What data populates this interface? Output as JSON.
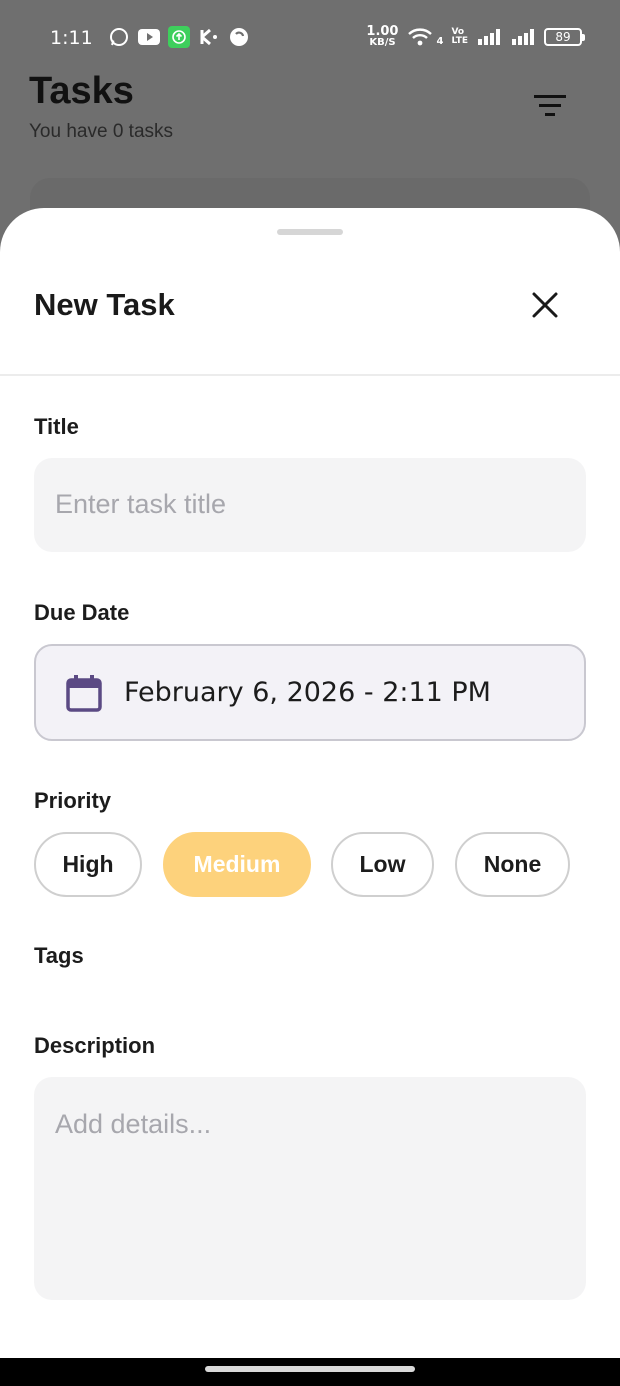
{
  "status_bar": {
    "time": "1:11",
    "net_speed_value": "1.00",
    "net_speed_unit": "KB/S",
    "network_type": "4",
    "volte_line1": "Vo",
    "volte_line2": "LTE",
    "battery": "89"
  },
  "background": {
    "title": "Tasks",
    "subtitle": "You have 0 tasks"
  },
  "sheet": {
    "title": "New Task",
    "title_label": "Title",
    "title_placeholder": "Enter task title",
    "due_label": "Due Date",
    "due_value": "February 6, 2026 - 2:11 PM",
    "priority_label": "Priority",
    "priorities": [
      "High",
      "Medium",
      "Low",
      "None"
    ],
    "selected_priority": "Medium",
    "tags_label": "Tags",
    "description_label": "Description",
    "description_placeholder": "Add details..."
  },
  "colors": {
    "accent": "#fdd27c",
    "calendar_icon": "#5b4a84",
    "field_bg": "#f4f4f5"
  }
}
